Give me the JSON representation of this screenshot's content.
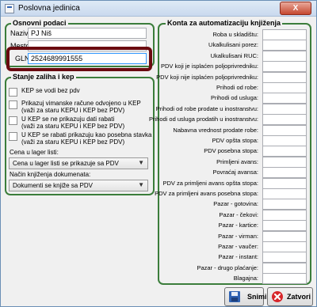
{
  "window": {
    "title": "Poslovna jedinica",
    "close_glyph": "X"
  },
  "basic": {
    "title": "Osnovni podaci",
    "naziv_label": "Naziv:",
    "naziv_value": "PJ Niš",
    "mesto_label": "Mesto:",
    "mesto_value": "",
    "gln_label": "GLN:",
    "gln_value": "2524689991555",
    "highlight_color": "#6a0a10"
  },
  "stock": {
    "title": "Stanje zaliha i kep",
    "checks": [
      {
        "label": "KEP se vodi bez pdv",
        "checked": false
      },
      {
        "label": "Prikazuj vimanske račune odvojeno u KEP\n(važi za staru KEPU i KEP bez PDV)",
        "checked": false
      },
      {
        "label": "U KEP se ne prikazuju dati rabati\n(važi za staru KEPU i  KEP bez PDV)",
        "checked": false
      },
      {
        "label": "U KEP se rabati prikazuju kao posebna stavka\n(važi za staru KEPU i KEP bez PDV)",
        "checked": false
      }
    ],
    "price_label": "Cena u lager listi:",
    "price_value": "Cena u lager listi se prikazuje sa PDV",
    "posting_label": "Način knjiženja dokumenata:",
    "posting_value": "Dokumenti se knjiže sa PDV"
  },
  "accounts": {
    "title": "Konta za automatizaciju knjiženja",
    "labels": [
      "Roba u skladištu:",
      "Ukalkulisani porez:",
      "Ukalkulisani RUC:",
      "PDV koji je isplaćen poljoprivredniku:",
      "PDV koji nije isplaćen poljoprivredniku:",
      "Prihodi od robe:",
      "Prihodi od usluga:",
      "Prihodi od robe prodate u inostranstvu:",
      "Prihodi od usluga prodatih u inostranstvu:",
      "Nabavna vrednost prodate robe:",
      "PDV opšta stopa:",
      "PDV posebna stopa:",
      "Primljeni avans:",
      "Povraćaj avansa:",
      "PDV za primljeni avans opšta stopa:",
      "PDV za primljeni avans posebna stopa:",
      "Pazar - gotovina:",
      "Pazar - čekovi:",
      "Pazar - kartice:",
      "Pazar - virman:",
      "Pazar - vaučer:",
      "Pazar - instant:",
      "Pazar - drugo plaćanje:",
      "Blagajna:"
    ]
  },
  "buttons": {
    "save": "Snimi",
    "close": "Zatvori"
  },
  "colors": {
    "group_border": "#3b7d3b",
    "save_icon": "#2f62b3",
    "close_icon": "#d7262a"
  }
}
